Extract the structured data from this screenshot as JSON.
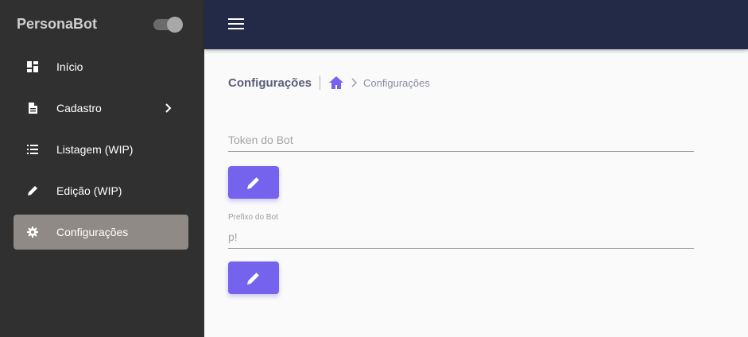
{
  "app": {
    "brand": "PersonaBot"
  },
  "sidebar": {
    "items": [
      {
        "label": "Início",
        "icon": "dashboard-icon"
      },
      {
        "label": "Cadastro",
        "icon": "document-icon"
      },
      {
        "label": "Listagem (WIP)",
        "icon": "list-icon"
      },
      {
        "label": "Edição (WIP)",
        "icon": "pencil-icon"
      },
      {
        "label": "Configurações",
        "icon": "gear-icon",
        "active": true
      }
    ]
  },
  "breadcrumb": {
    "title": "Configurações",
    "current": "Configurações"
  },
  "form": {
    "token": {
      "placeholder": "Token do Bot",
      "value": ""
    },
    "prefix": {
      "label": "Prefixo do Bot",
      "value": "p!"
    }
  },
  "colors": {
    "accent": "#7563ed",
    "topbar": "#222a48",
    "sidebar": "#303030",
    "active_item": "#8f8a86"
  }
}
